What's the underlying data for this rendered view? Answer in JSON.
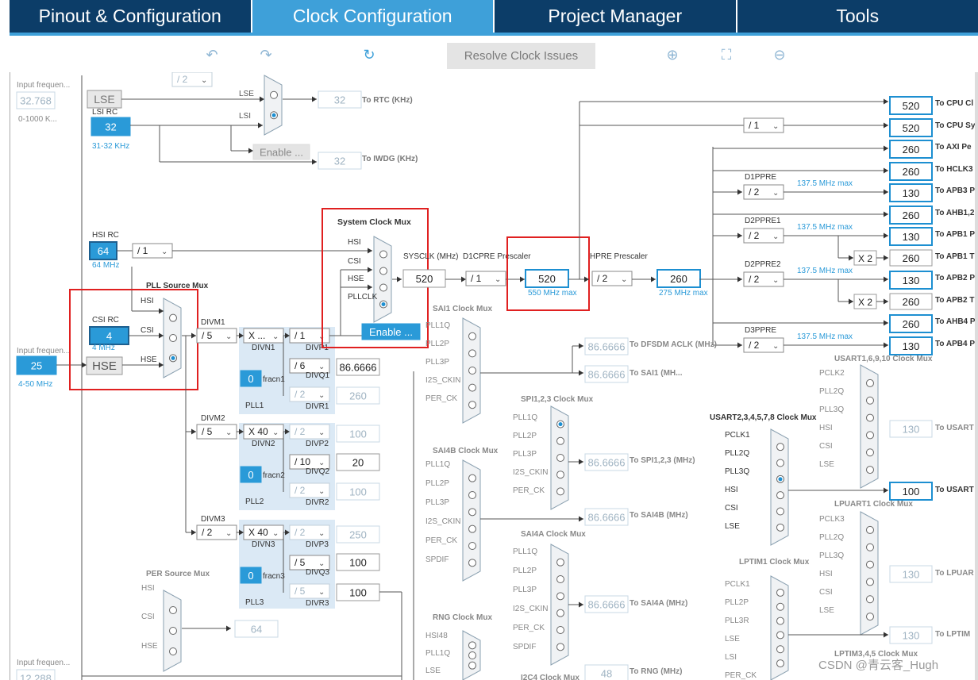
{
  "tabs": [
    "Pinout & Configuration",
    "Clock Configuration",
    "Project Manager",
    "Tools"
  ],
  "toolbar": {
    "undo": "undo-icon",
    "redo": "redo-icon",
    "refresh": "refresh-icon",
    "resolve": "Resolve Clock Issues",
    "zoom_in": "zoom-in-icon",
    "fit": "fit-icon",
    "zoom_out": "zoom-out-icon"
  },
  "left": {
    "input_freq": "Input frequen...",
    "lse_value": "32.768",
    "lse_range": "0-1000 K...",
    "lse": "LSE",
    "lsi_rc": "LSI RC",
    "lsi_value": "32",
    "lsi_range": "31-32 KHz",
    "hsi_rc": "HSI RC",
    "hsi_value": "64",
    "hsi_mhz": "64 MHz",
    "csi_rc": "CSI RC",
    "csi_value": "4",
    "csi_mhz": "4 MHz",
    "hse_input": "Input frequen...",
    "hse_value": "25",
    "hse_range": "4-50 MHz",
    "hse": "HSE",
    "bottom_input": "Input frequen...",
    "bottom_value": "12.288"
  },
  "rtc": {
    "mux_lse": "LSE",
    "mux_lsi": "LSI",
    "enable": "Enable ...",
    "rtc_val": "32",
    "rtc_label": "To RTC (KHz)",
    "iwdg_val": "32",
    "iwdg_label": "To IWDG (KHz)",
    "top_div": "/ 2"
  },
  "sysmux": {
    "title": "System Clock Mux",
    "hsi": "HSI",
    "csi": "CSI",
    "hse": "HSE",
    "pllclk": "PLLCLK",
    "enable": "Enable ..."
  },
  "pllsrc": {
    "title": "PLL Source Mux",
    "hsi": "HSI",
    "csi": "CSI",
    "hse": "HSE"
  },
  "hsi_div": "/ 1",
  "sysclk": {
    "label": "SYSCLK (MHz)",
    "value": "520",
    "d1cpre_label": "D1CPRE Prescaler",
    "d1cpre": "/ 1",
    "cpu_value": "520",
    "cpu_max": "550 MHz max",
    "hpre_label": "HPRE Prescaler",
    "hpre": "/ 2",
    "hclk": "260",
    "hclk_max": "275 MHz max"
  },
  "pll1": {
    "divm_label": "DIVM1",
    "divm": "/ 5",
    "divn": "X ...",
    "divn_label": "DIVN1",
    "fracn": "0",
    "fracn_label": "fracn1",
    "divp": "/ 1",
    "divp_label": "DIVP1",
    "divq": "/ 6",
    "divq_label": "DIVQ1",
    "divq_val": "86.6666",
    "divr": "/ 2",
    "divr_label": "DIVR1",
    "divr_val": "260",
    "name": "PLL1"
  },
  "pll2": {
    "divm_label": "DIVM2",
    "divm": "/ 5",
    "divn": "X 40",
    "divn_label": "DIVN2",
    "fracn": "0",
    "fracn_label": "fracn2",
    "divp": "/ 2",
    "divp_label": "DIVP2",
    "divp_val": "100",
    "divq": "/ 10",
    "divq_label": "DIVQ2",
    "divq_val": "20",
    "divr": "/ 2",
    "divr_label": "DIVR2",
    "divr_val": "100",
    "name": "PLL2"
  },
  "pll3": {
    "divm_label": "DIVM3",
    "divm": "/ 2",
    "divn": "X 40",
    "divn_label": "DIVN3",
    "fracn": "0",
    "fracn_label": "fracn3",
    "divp": "/ 2",
    "divp_label": "DIVP3",
    "divp_val": "250",
    "divq": "/ 5",
    "divq_label": "DIVQ3",
    "divq_val": "100",
    "divr": "/ 5",
    "divr_label": "DIVR3",
    "divr_val": "100",
    "name": "PLL3"
  },
  "per": {
    "title": "PER Source Mux",
    "hsi": "HSI",
    "csi": "CSI",
    "hse": "HSE",
    "value": "64"
  },
  "sai1": {
    "title": "SAI1 Clock Mux",
    "inputs": [
      "PLL1Q",
      "PLL2P",
      "PLL3P",
      "I2S_CKIN",
      "PER_CK"
    ],
    "dfsdm_val": "86.6666",
    "dfsdm_label": "To DFSDM ACLK (MHz)",
    "sai_val": "86.6666",
    "sai_label": "To SAI1 (MH..."
  },
  "sai4b": {
    "title": "SAI4B Clock Mux",
    "inputs": [
      "PLL1Q",
      "PLL2P",
      "PLL3P",
      "I2S_CKIN",
      "PER_CK",
      "SPDIF"
    ],
    "val": "86.6666",
    "label": "To SAI4B (MHz)"
  },
  "spi": {
    "title": "SPI1,2,3 Clock Mux",
    "inputs": [
      "PLL1Q",
      "PLL2P",
      "PLL3P",
      "I2S_CKIN",
      "PER_CK"
    ],
    "val": "86.6666",
    "label": "To SPI1,2,3 (MHz)"
  },
  "sai4a": {
    "title": "SAI4A Clock Mux",
    "inputs": [
      "PLL1Q",
      "PLL2P",
      "PLL3P",
      "I2S_CKIN",
      "PER_CK",
      "SPDIF"
    ],
    "val": "86.6666",
    "label": "To SAI4A (MHz)"
  },
  "rng": {
    "title": "RNG Clock Mux",
    "inputs": [
      "HSI48",
      "PLL1Q",
      "LSE"
    ],
    "val": "48",
    "label": "To RNG (MHz)"
  },
  "i2c4": {
    "title": "I2C4 Clock Mux"
  },
  "outputs": [
    {
      "val": "520",
      "label": "To CPU Cl"
    },
    {
      "val": "520",
      "label": "To CPU Sy"
    },
    {
      "val": "260",
      "label": "To AXI Pe"
    },
    {
      "val": "260",
      "label": "To HCLK3"
    },
    {
      "val": "130",
      "label": "To APB3 P"
    },
    {
      "val": "260",
      "label": "To AHB1,2"
    },
    {
      "val": "130",
      "label": "To APB1 P"
    },
    {
      "val": "260",
      "label": "To APB1 T"
    },
    {
      "val": "130",
      "label": "To APB2 P"
    },
    {
      "val": "260",
      "label": "To APB2 T"
    },
    {
      "val": "260",
      "label": "To AHB4 P"
    },
    {
      "val": "130",
      "label": "To APB4 P"
    }
  ],
  "presc": {
    "div1": "/ 1",
    "d1ppre_label": "D1PPRE",
    "d1ppre": "/ 2",
    "d2ppre1_label": "D2PPRE1",
    "d2ppre1": "/ 2",
    "d2ppre2_label": "D2PPRE2",
    "d2ppre2": "/ 2",
    "d3ppre_label": "D3PPRE",
    "d3ppre": "/ 2",
    "max": "137.5 MHz max",
    "x2": "X 2"
  },
  "usart16": {
    "title": "USART1,6,9,10 Clock Mux",
    "inputs": [
      "PCLK2",
      "PLL2Q",
      "PLL3Q",
      "HSI",
      "CSI",
      "LSE"
    ],
    "val": "130",
    "label": "To USART"
  },
  "usart2": {
    "title": "USART2,3,4,5,7,8 Clock Mux",
    "inputs": [
      "PCLK1",
      "PLL2Q",
      "PLL3Q",
      "HSI",
      "CSI",
      "LSE"
    ],
    "val": "100",
    "label": "To USART"
  },
  "lpuart": {
    "title": "LPUART1 Clock Mux",
    "inputs": [
      "PCLK3",
      "PLL2Q",
      "PLL3Q",
      "HSI",
      "CSI",
      "LSE"
    ],
    "val": "130",
    "label": "To LPUAR"
  },
  "lptim1": {
    "title": "LPTIM1 Clock Mux",
    "inputs": [
      "PCLK1",
      "PLL2P",
      "PLL3R",
      "LSE",
      "LSI",
      "PER_CK"
    ],
    "val": "130",
    "label": "To LPTIM"
  },
  "lptim345": {
    "title": "LPTIM3,4,5 Clock Mux"
  },
  "watermark": "CSDN @青云客_Hugh"
}
